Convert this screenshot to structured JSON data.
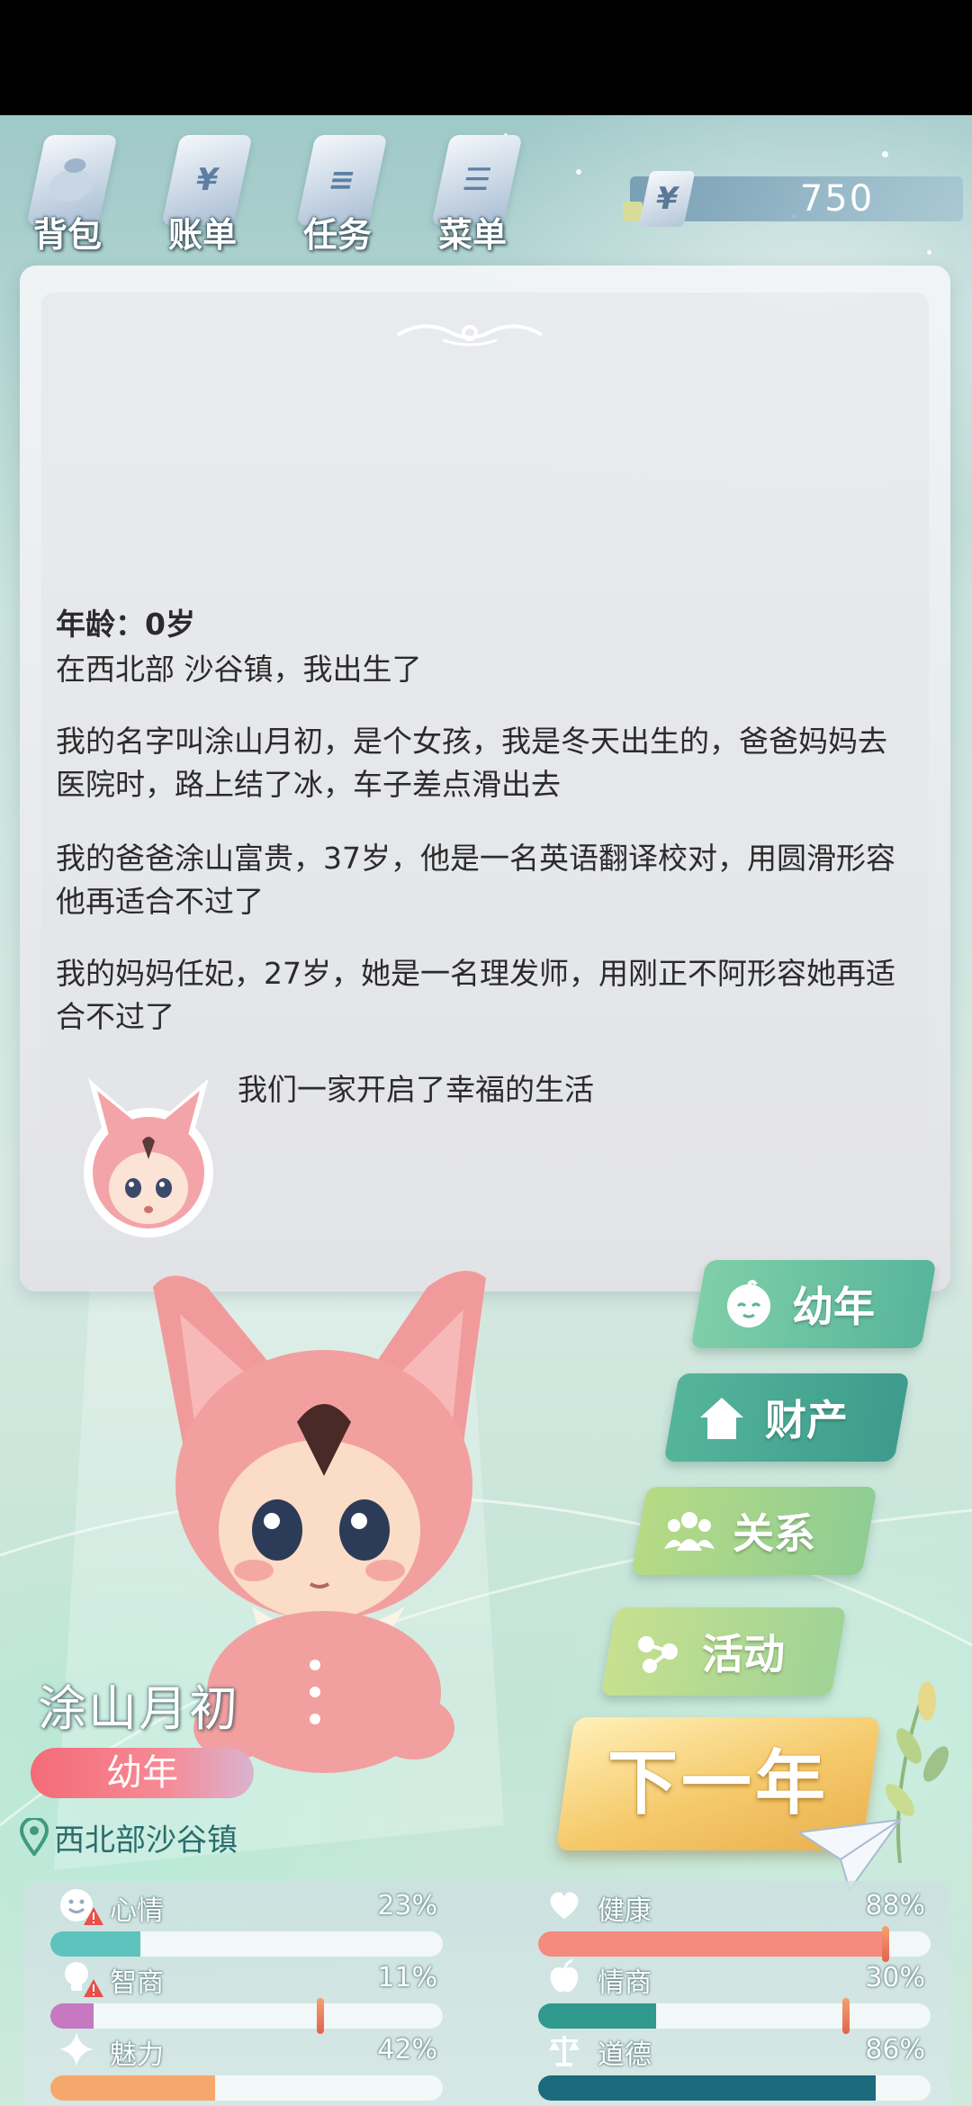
{
  "toolbar": {
    "items": [
      {
        "label": "背包",
        "icon": "backpack-icon",
        "glyph": ""
      },
      {
        "label": "账单",
        "icon": "bill-icon",
        "glyph": "¥"
      },
      {
        "label": "任务",
        "icon": "task-list-icon",
        "glyph": "≡"
      },
      {
        "label": "菜单",
        "icon": "menu-icon",
        "glyph": "☰"
      }
    ]
  },
  "money": {
    "currency_symbol": "¥",
    "value": "750"
  },
  "story": {
    "age_line": "年龄：0岁",
    "paragraphs": [
      "在西北部 沙谷镇，我出生了",
      "我的名字叫涂山月初，是个女孩，我是冬天出生的，爸爸妈妈去医院时，路上结了冰，车子差点滑出去",
      "我的爸爸涂山富贵，37岁，他是一名英语翻译校对，用圆滑形容他再适合不过了",
      "我的妈妈任妃，27岁，她是一名理发师，用刚正不阿形容她再适合不过了",
      "我们一家开启了幸福的生活"
    ]
  },
  "categories": {
    "youth": "幼年",
    "property": "财产",
    "relations": "关系",
    "activity": "活动"
  },
  "next_year": "下一年",
  "character": {
    "name": "涂山月初",
    "stage": "幼年",
    "location": "西北部沙谷镇"
  },
  "stats": {
    "mood": {
      "label": "心情",
      "value": "23%",
      "percent": 23,
      "color": "#5ec3bd",
      "warning": true
    },
    "health": {
      "label": "健康",
      "value": "88%",
      "percent": 88,
      "color": "#f38b7f",
      "warning": false
    },
    "iq": {
      "label": "智商",
      "value": "11%",
      "percent": 11,
      "color": "#c678c0",
      "warning": true
    },
    "eq": {
      "label": "情商",
      "value": "30%",
      "percent": 30,
      "color": "#2f9a8d",
      "warning": false
    },
    "charm": {
      "label": "魅力",
      "value": "42%",
      "percent": 42,
      "color": "#f6a86c",
      "warning": false
    },
    "morality": {
      "label": "道德",
      "value": "86%",
      "percent": 86,
      "color": "#1d6a7c",
      "warning": false
    }
  },
  "colors": {
    "accent_green": "#58b59b",
    "next_year_gold": "#f5c96a",
    "stage_pink": "#f46b78"
  }
}
